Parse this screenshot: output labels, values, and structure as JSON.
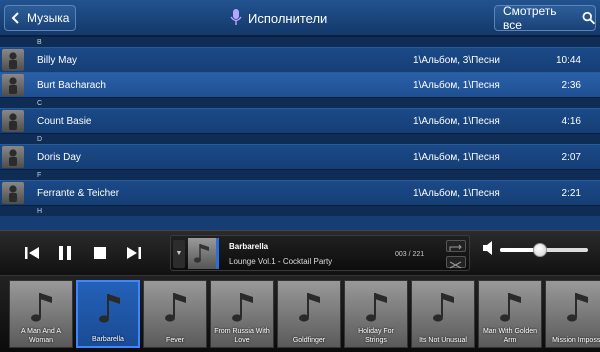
{
  "header": {
    "back_label": "Музыка",
    "title": "Исполнители",
    "see_all_label": "Смотреть все"
  },
  "list": [
    {
      "section": "B"
    },
    {
      "name": "Billy May",
      "info": "1\\Альбом, 3\\Песни",
      "duration": "10:44",
      "selected": false
    },
    {
      "name": "Burt Bacharach",
      "info": "1\\Альбом, 1\\Песня",
      "duration": "2:36",
      "selected": true
    },
    {
      "section": "C"
    },
    {
      "name": "Count Basie",
      "info": "1\\Альбом, 1\\Песня",
      "duration": "4:16",
      "selected": false
    },
    {
      "section": "D"
    },
    {
      "name": "Doris Day",
      "info": "1\\Альбом, 1\\Песня",
      "duration": "2:07",
      "selected": false
    },
    {
      "section": "F"
    },
    {
      "name": "Ferrante & Teicher",
      "info": "1\\Альбом, 1\\Песня",
      "duration": "2:21",
      "selected": false
    },
    {
      "section": "H"
    }
  ],
  "player": {
    "song_title": "Barbarella",
    "album_line": "Lounge Vol.1 - Cocktail Party",
    "track_counter": "003 / 221",
    "volume_fraction": 0.45
  },
  "albums": [
    {
      "label": "A Man And A Woman",
      "selected": false
    },
    {
      "label": "Barbarella",
      "selected": true
    },
    {
      "label": "Fever",
      "selected": false
    },
    {
      "label": "From Russia With Love",
      "selected": false
    },
    {
      "label": "Goldfinger",
      "selected": false
    },
    {
      "label": "Holiday For Strings",
      "selected": false
    },
    {
      "label": "Its Not Unusual",
      "selected": false
    },
    {
      "label": "Man With Golden Arm",
      "selected": false
    },
    {
      "label": "Mission Impossi",
      "selected": false
    }
  ],
  "colors": {
    "accent": "#3c86ff",
    "header": "#1c4a85",
    "row": "#1b4a88"
  }
}
